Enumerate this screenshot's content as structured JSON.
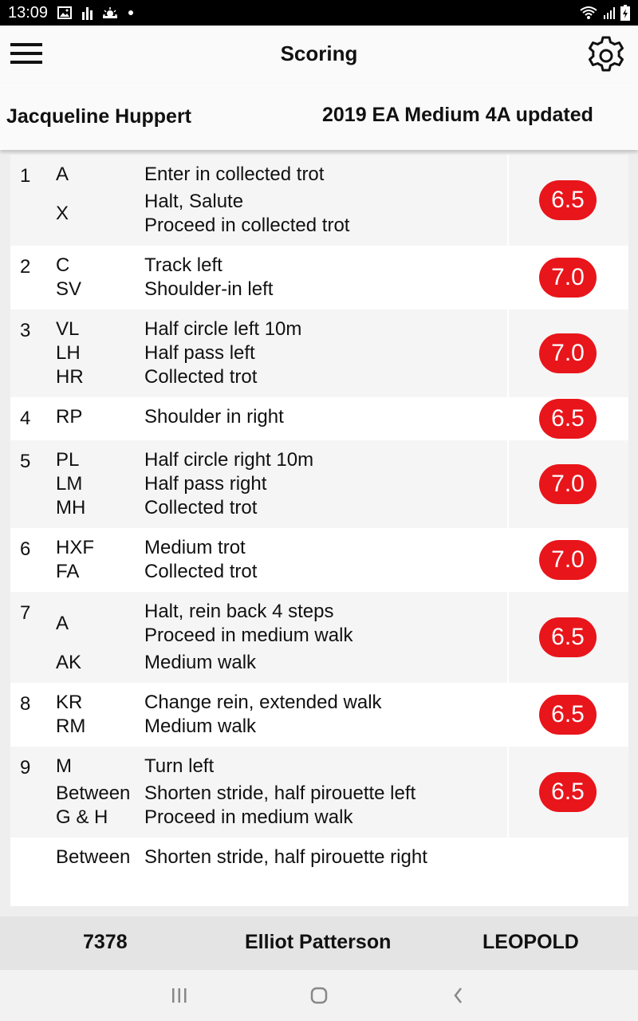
{
  "status_bar": {
    "time": "13:09",
    "left_icons": [
      "image-icon",
      "chart-icon",
      "weather-icon",
      "dot-icon"
    ],
    "right_icons": [
      "wifi-icon",
      "signal-icon",
      "battery-charging-icon"
    ]
  },
  "app_bar": {
    "title": "Scoring",
    "menu_icon": "hamburger-icon",
    "settings_icon": "gear-icon"
  },
  "subheader": {
    "rider": "Jacqueline Huppert",
    "test": "2019 EA Medium 4A updated"
  },
  "movements": [
    {
      "num": "1",
      "groups": [
        {
          "lines": [
            {
              "letter": "A",
              "desc": "Enter in collected trot"
            }
          ]
        },
        {
          "lines": [
            {
              "letter": "X",
              "desc": "Halt, Salute"
            },
            {
              "letter": "",
              "desc": "Proceed in collected trot"
            }
          ],
          "letter_mid": true
        }
      ],
      "score": "6.5"
    },
    {
      "num": "2",
      "groups": [
        {
          "lines": [
            {
              "letter": "C",
              "desc": "Track left"
            },
            {
              "letter": "SV",
              "desc": "Shoulder-in left"
            }
          ]
        }
      ],
      "score": "7.0"
    },
    {
      "num": "3",
      "groups": [
        {
          "lines": [
            {
              "letter": "VL",
              "desc": "Half circle left 10m"
            },
            {
              "letter": "LH",
              "desc": "Half pass left"
            },
            {
              "letter": "HR",
              "desc": "Collected trot"
            }
          ]
        }
      ],
      "score": "7.0"
    },
    {
      "num": "4",
      "groups": [
        {
          "lines": [
            {
              "letter": "RP",
              "desc": "Shoulder in right"
            }
          ]
        }
      ],
      "score": "6.5"
    },
    {
      "num": "5",
      "groups": [
        {
          "lines": [
            {
              "letter": "PL",
              "desc": "Half circle right 10m"
            },
            {
              "letter": "LM",
              "desc": "Half pass right"
            },
            {
              "letter": "MH",
              "desc": "Collected trot"
            }
          ]
        }
      ],
      "score": "7.0"
    },
    {
      "num": "6",
      "groups": [
        {
          "lines": [
            {
              "letter": "HXF",
              "desc": "Medium trot"
            },
            {
              "letter": "FA",
              "desc": "Collected trot"
            }
          ]
        }
      ],
      "score": "7.0"
    },
    {
      "num": "7",
      "groups": [
        {
          "lines": [
            {
              "letter": "A",
              "desc": "Halt, rein back 4 steps"
            },
            {
              "letter": "",
              "desc": "Proceed in medium walk"
            }
          ],
          "letter_mid": true
        },
        {
          "lines": [
            {
              "letter": "AK",
              "desc": "Medium walk"
            }
          ]
        }
      ],
      "score": "6.5"
    },
    {
      "num": "8",
      "groups": [
        {
          "lines": [
            {
              "letter": "KR",
              "desc": "Change rein, extended walk"
            },
            {
              "letter": "RM",
              "desc": "Medium walk"
            }
          ]
        }
      ],
      "score": "6.5"
    },
    {
      "num": "9",
      "groups": [
        {
          "lines": [
            {
              "letter": "M",
              "desc": "Turn left"
            }
          ]
        },
        {
          "lines": [
            {
              "letter": "Between",
              "desc": "Shorten stride, half pirouette left"
            },
            {
              "letter": "G & H",
              "desc": "Proceed in medium walk"
            }
          ]
        }
      ],
      "score": "6.5"
    },
    {
      "num": "",
      "groups": [
        {
          "lines": [
            {
              "letter": "Between",
              "desc": "Shorten stride, half pirouette right"
            }
          ]
        }
      ],
      "score": ""
    }
  ],
  "footer": {
    "competitor_number": "7378",
    "rider": "Elliot Patterson",
    "horse": "LEOPOLD"
  },
  "nav": [
    "recent-apps-icon",
    "home-icon",
    "back-icon"
  ],
  "colors": {
    "score_badge": "#e8151b",
    "status_bar": "#000000",
    "app_bar": "#fafafa",
    "row_alt": "#f5f5f5",
    "footer": "#e4e4e4"
  }
}
